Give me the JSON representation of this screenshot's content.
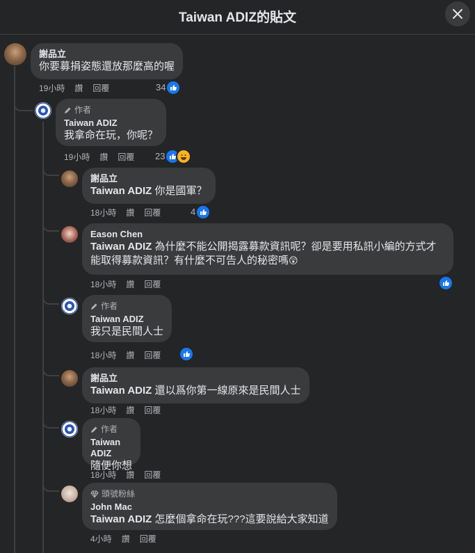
{
  "header": {
    "title": "Taiwan ADIZ的貼文"
  },
  "labels": {
    "author_badge": "作者",
    "fan_badge": "頭號粉絲"
  },
  "actions": {
    "like": "讚",
    "reply": "回覆"
  },
  "comments": [
    {
      "author": "謝品立",
      "text": "你要募捐姿態還放那麼高的喔",
      "time": "19小時",
      "reactions": "34"
    },
    {
      "author": "Taiwan ADIZ",
      "text": "我拿命在玩，你呢？",
      "time": "19小時",
      "reactions": "23"
    },
    {
      "author": "謝品立",
      "tag": "Taiwan ADIZ",
      "text": " 你是國軍？",
      "time": "18小時",
      "reactions": "4"
    },
    {
      "author": "Eason Chen",
      "tag": "Taiwan ADIZ",
      "text": " 為什麼不能公開揭露募款資訊呢？卻是要用私訊小編的方式才能取得募款資訊？有什麼不可告人的秘密嗎",
      "time": "18小時",
      "emoji": "😲"
    },
    {
      "author": "Taiwan ADIZ",
      "text": "我只是民間人士",
      "time": "18小時"
    },
    {
      "author": "謝品立",
      "tag": "Taiwan ADIZ",
      "text": " 還以爲你第一線原來是民間人士",
      "time": "18小時"
    },
    {
      "author": "Taiwan ADIZ",
      "text": "隨便你想",
      "time": "18小時"
    },
    {
      "author": "John Mac",
      "tag": "Taiwan ADIZ",
      "text": " 怎麼個拿命在玩???這要說給大家知道",
      "time": "4小時"
    }
  ],
  "colors": {
    "background": "#242526",
    "bubble": "#3a3b3c",
    "like": "#1877f2",
    "haha": "#f7b125"
  }
}
